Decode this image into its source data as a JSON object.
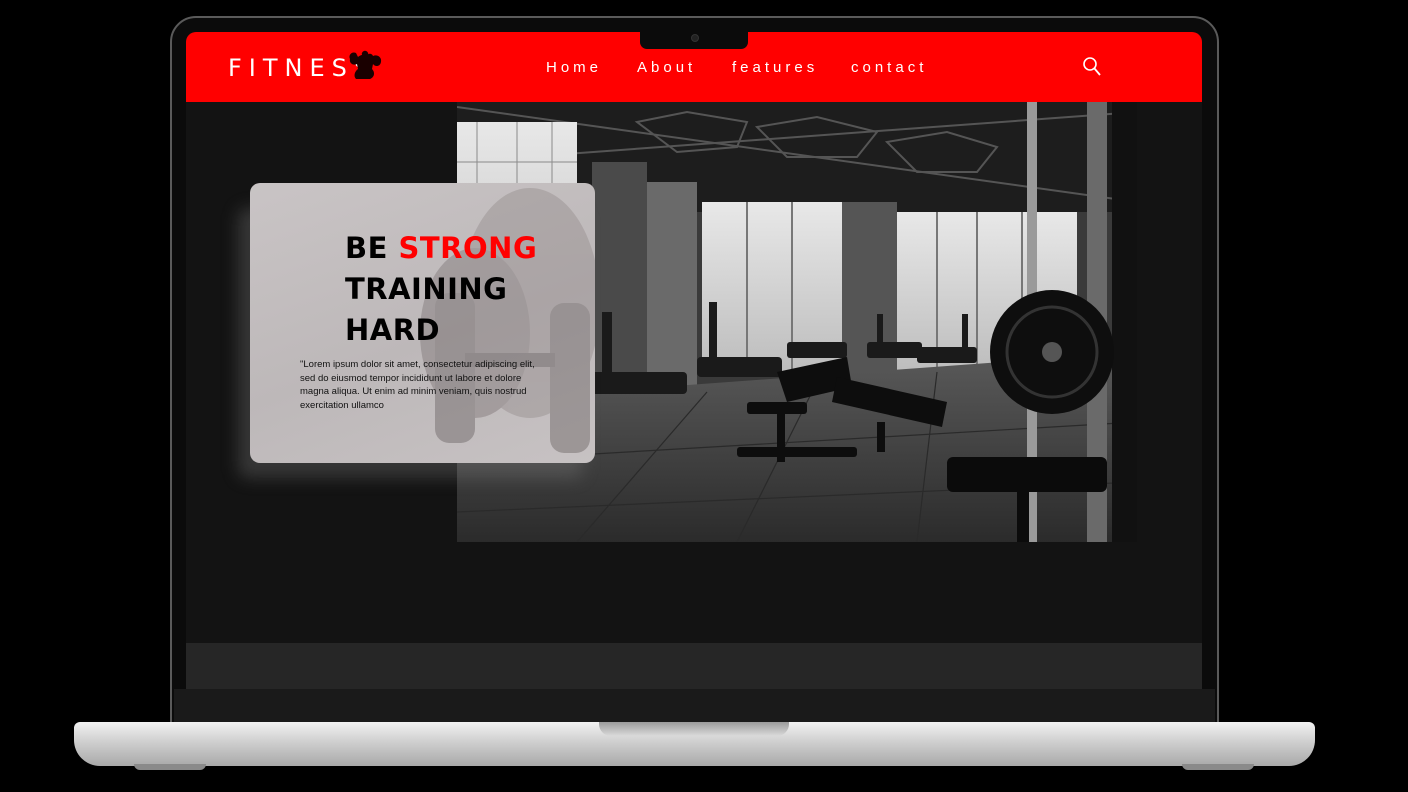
{
  "brand": {
    "name": "FITNESS",
    "logo_icon": "flexing-bodybuilder-icon",
    "accent": "#ff0000"
  },
  "nav": {
    "items": [
      {
        "label": "Home"
      },
      {
        "label": "About"
      },
      {
        "label": "features"
      },
      {
        "label": "contact"
      }
    ],
    "search_icon": "search-icon"
  },
  "hero": {
    "headline_word1": "BE ",
    "headline_word2": "STRONG",
    "headline_line2": "TRAINING",
    "headline_line3": "HARD",
    "paragraph": "\"Lorem ipsum dolor sit amet, consectetur adipiscing elit, sed do eiusmod tempor incididunt ut labore et dolore magna aliqua. Ut enim ad minim veniam, quis nostrud exercitation ullamco",
    "image": "gym-interior-photo"
  }
}
